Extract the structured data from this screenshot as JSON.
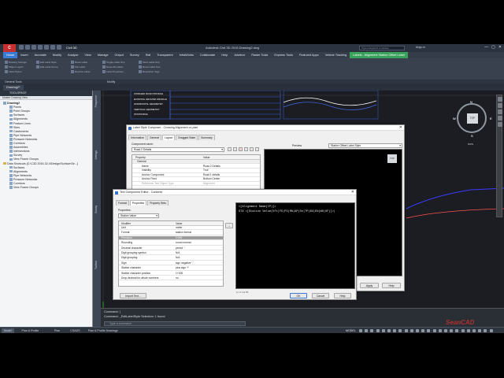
{
  "window": {
    "app_brand": "Civil 3D",
    "title": "Autodesk Civil 3D 2016   Drawing2.dwg",
    "search_placeholder": "Type a keyword or phrase",
    "user": "kepp-m",
    "minimize": "—",
    "maximize": "▢",
    "close": "✕"
  },
  "menu": {
    "items": [
      "Home",
      "Insert",
      "Annotate",
      "Modify",
      "Analyze",
      "View",
      "Manage",
      "Output",
      "Survey",
      "Rail",
      "Transparent",
      "InfraWorks",
      "Collaborate",
      "Help",
      "Jukebox",
      "Raster Tools",
      "Express Tools",
      "Featured Apps",
      "Vehicle Tracking"
    ],
    "active_index": 0,
    "contextual": "Labels - Alignment Station Offset Label"
  },
  "ribbon": {
    "left_buttons": [
      "Drawing Settings",
      "Object Layers",
      "Label Styles",
      "Edit Label Style",
      "Edit Label Group"
    ],
    "mid_buttons": [
      "Reset Label",
      "Flip Label",
      "Reverse Label",
      "Toggle Label Grip",
      "Reset All Labels",
      "Label Properties"
    ],
    "right_buttons": [
      "Send Label Grip",
      "Reset Label Text",
      "Reposition Tags"
    ],
    "group_general": "General Tools",
    "group_modify": "Modify"
  },
  "file_tab": "Drawing2*",
  "toolspace": {
    "title": "TOOLSPACE",
    "view": "Master Drawing View",
    "tree": [
      {
        "label": "Drawing2",
        "level": 1,
        "bold": true
      },
      {
        "label": "Points",
        "level": 2
      },
      {
        "label": "Point Groups",
        "level": 2
      },
      {
        "label": "Surfaces",
        "level": 2
      },
      {
        "label": "Alignments",
        "level": 2
      },
      {
        "label": "Feature Lines",
        "level": 2
      },
      {
        "label": "Sites",
        "level": 2
      },
      {
        "label": "Catchments",
        "level": 2
      },
      {
        "label": "Pipe Networks",
        "level": 2
      },
      {
        "label": "Pressure Networks",
        "level": 2
      },
      {
        "label": "Corridors",
        "level": 2
      },
      {
        "label": "Assemblies",
        "level": 2
      },
      {
        "label": "Intersections",
        "level": 2
      },
      {
        "label": "Survey",
        "level": 2
      },
      {
        "label": "View Frame Groups",
        "level": 2
      },
      {
        "label": "Data Shortcuts [C:\\C3D 2016-32-4\\Design\\Surface\\Se...]",
        "level": 1,
        "folder": true
      },
      {
        "label": "Surfaces",
        "level": 2
      },
      {
        "label": "Alignments",
        "level": 2
      },
      {
        "label": "Pipe Networks",
        "level": 2
      },
      {
        "label": "Pressure Networks",
        "level": 2
      },
      {
        "label": "Corridors",
        "level": 2
      },
      {
        "label": "View Frame Groups",
        "level": 2
      }
    ],
    "side_tabs": [
      "Prospector",
      "Settings",
      "Survey",
      "Toolbox"
    ]
  },
  "profile_labels": [
    "FINISHED ROAD PROFILE",
    "EXISTING GROUND PROFILE",
    "HORIZONTAL GEOMETRY",
    "VERTICAL GEOMETRY",
    "STATIONING"
  ],
  "viewcube": {
    "top": "TOP",
    "n": "N",
    "e": "E",
    "s": "S",
    "w": "W",
    "wcs": "WCS"
  },
  "composer": {
    "title": "Label Style Composer - Crossing Alignment on plan",
    "tabs": [
      "Information",
      "General",
      "Layout",
      "Dragged State",
      "Summary"
    ],
    "active_tab": 2,
    "component_name_label": "Component name:",
    "component_name": "Road 2 Details",
    "prop_header": "Property",
    "value_header": "Value",
    "rows": [
      {
        "p": "General",
        "v": "",
        "group": true
      },
      {
        "p": "Name",
        "v": "Road 2 Details"
      },
      {
        "p": "Visibility",
        "v": "True"
      },
      {
        "p": "Anchor Component",
        "v": "Road 1 details"
      },
      {
        "p": "Anchor Point",
        "v": "Bottom Center"
      },
      {
        "p": "Reference Text Object Type",
        "v": "Alignment",
        "disabled": true
      }
    ],
    "preview_label": "Preview",
    "preview_select": "Station Offset Label Style",
    "preview_top": "TOP",
    "apply": "Apply",
    "help": "Help"
  },
  "editor": {
    "title": "Text Component Editor - Contents",
    "tabs": [
      "Format",
      "Properties",
      "Property Sets"
    ],
    "active_tab": 1,
    "properties_label": "Properties:",
    "properties_value": "Station Value",
    "modifier_header": "Modifier",
    "value_header": "Value",
    "rows": [
      {
        "m": "Unit",
        "v": "meter"
      },
      {
        "m": "Format",
        "v": "station format"
      },
      {
        "m": "Precision",
        "v": "0.000",
        "sel": true
      },
      {
        "m": "Rounding",
        "v": "round normal"
      },
      {
        "m": "Decimal character",
        "v": "period '.'"
      },
      {
        "m": "Digit grouping symbol",
        "v": "N/A"
      },
      {
        "m": "Digit grouping",
        "v": "N/A"
      },
      {
        "m": "Sign",
        "v": "sign negative '-'"
      },
      {
        "m": "Station character",
        "v": "plus sign '+'"
      },
      {
        "m": "Station character position",
        "v": "1+000"
      },
      {
        "m": "Drop decimal for whole numbers",
        "v": "no"
      }
    ],
    "insert_arrow": "→",
    "text_line1": "<[Alignment Name(CP)]>",
    "text_line2": "STA <[Station Value(Uft|FS|P3|RN|AP|Sn|TP|B3|EN|W0|OF)]>|",
    "status": "Ln 2 Col 56",
    "import_text": "Import Text...",
    "ok": "OK",
    "cancel": "Cancel",
    "help": "Help"
  },
  "command": {
    "line1": "Command: |",
    "line2": "Command: _EditLabelStyle  Selection: 1 found",
    "prompt": "Type a command"
  },
  "status": {
    "tabs": [
      "Model",
      "Plan & Profile",
      "Plan",
      "CSADS",
      "Plan & Profile Drawings"
    ],
    "active_index": 0,
    "model": "MODEL"
  },
  "watermark": "SeanCAD",
  "colors": {
    "accent": "#3a7bd5",
    "contextual": "#38a15a",
    "profile_outline": "#3b64d8",
    "canvas": "#1b1d22"
  }
}
